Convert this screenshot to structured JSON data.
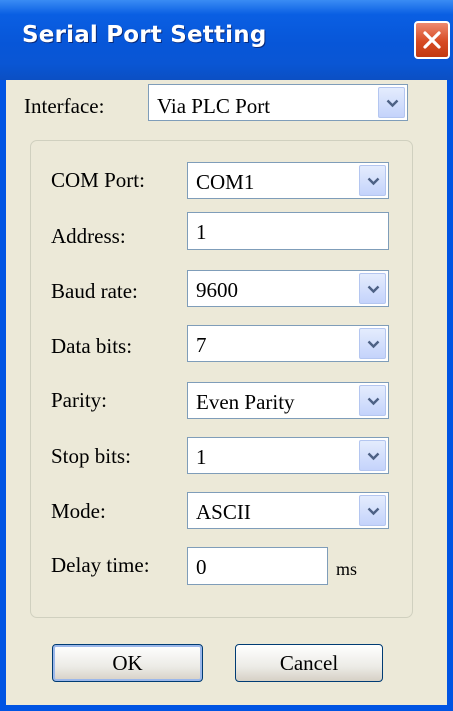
{
  "window": {
    "title": "Serial Port Setting"
  },
  "interface": {
    "label": "Interface:",
    "value": "Via PLC Port"
  },
  "com_port": {
    "label": "COM Port:",
    "value": "COM1"
  },
  "address": {
    "label": "Address:",
    "value": "1"
  },
  "baud_rate": {
    "label": "Baud rate:",
    "value": "9600"
  },
  "data_bits": {
    "label": "Data bits:",
    "value": "7"
  },
  "parity": {
    "label": "Parity:",
    "value": "Even Parity"
  },
  "stop_bits": {
    "label": "Stop bits:",
    "value": "1"
  },
  "mode": {
    "label": "Mode:",
    "value": "ASCII"
  },
  "delay_time": {
    "label": "Delay time:",
    "value": "0",
    "unit": "ms"
  },
  "buttons": {
    "ok": "OK",
    "cancel": "Cancel"
  },
  "icons": {
    "close": "close-icon",
    "dropdown": "chevron-down-icon"
  },
  "colors": {
    "titlebar": "#0054e3",
    "dialog_bg": "#ece9d8",
    "close_button": "#d74a22",
    "field_border": "#7f9db9"
  }
}
